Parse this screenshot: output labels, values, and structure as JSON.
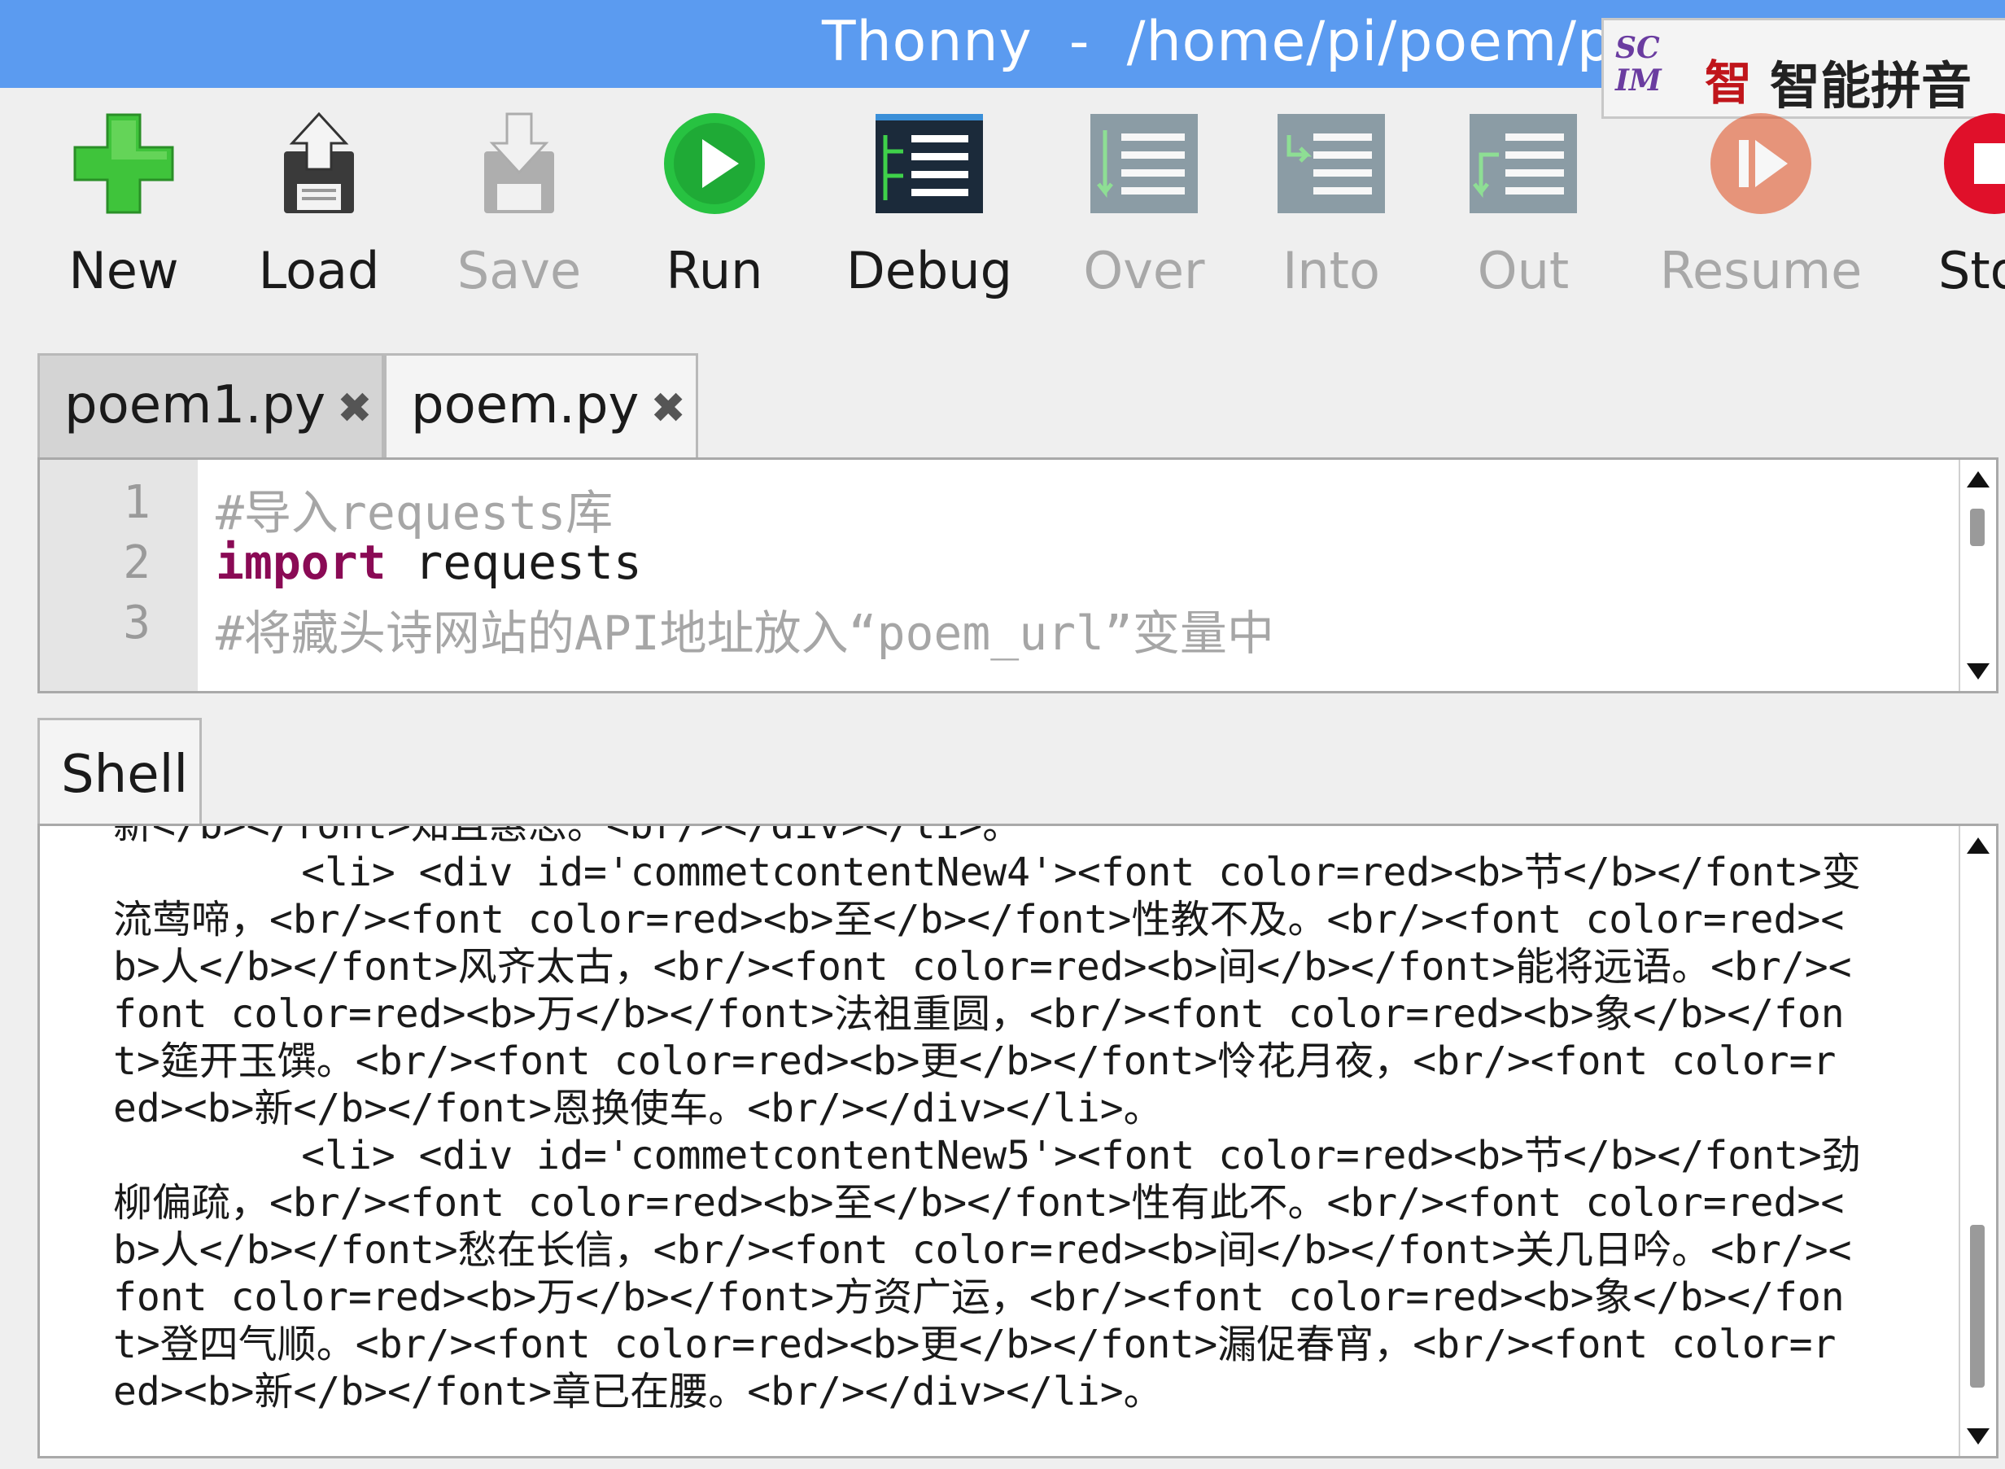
{
  "window": {
    "title": "Thonny  -  /home/pi/poem/poem"
  },
  "ime": {
    "logo_line1": "SC",
    "logo_line2": "IM",
    "mode": "智",
    "name": "智能拼音"
  },
  "toolbar": {
    "new": "New",
    "load": "Load",
    "save": "Save",
    "run": "Run",
    "debug": "Debug",
    "over": "Over",
    "into": "Into",
    "out": "Out",
    "resume": "Resume",
    "stop": "Sto"
  },
  "editor_tabs": [
    {
      "label": "poem1.py",
      "close": "✖"
    },
    {
      "label": "poem.py",
      "close": "✖"
    }
  ],
  "editor": {
    "line_numbers": [
      "1",
      "2",
      "3"
    ],
    "lines": [
      {
        "text": "#导入requests库"
      },
      {
        "keyword": "import",
        "text": " requests"
      },
      {
        "text": "#将藏头诗网站的API地址放入“poem_url”变量中"
      }
    ]
  },
  "shell": {
    "tab": "Shell",
    "lines": [
      "新</b></font>知且惠思。<br/></div></li>。",
      "        <li> <div id='commetcontentNew4'><font color=red><b>节</b></font>变",
      "流莺啼，<br/><font color=red><b>至</b></font>性教不及。<br/><font color=red><",
      "b>人</b></font>风齐太古，<br/><font color=red><b>间</b></font>能将远语。<br/><",
      "font color=red><b>万</b></font>法祖重圆，<br/><font color=red><b>象</b></fon",
      "t>筵开玉馔。<br/><font color=red><b>更</b></font>怜花月夜，<br/><font color=r",
      "ed><b>新</b></font>恩换使车。<br/></div></li>。",
      "        <li> <div id='commetcontentNew5'><font color=red><b>节</b></font>劲",
      "柳偏疏，<br/><font color=red><b>至</b></font>性有此不。<br/><font color=red><",
      "b>人</b></font>愁在长信，<br/><font color=red><b>间</b></font>关几日吟。<br/><",
      "font color=red><b>万</b></font>方资广运，<br/><font color=red><b>象</b></fon",
      "t>登四气顺。<br/><font color=red><b>更</b></font>漏促春宵，<br/><font color=r",
      "ed><b>新</b></font>章已在腰。<br/></div></li>。"
    ]
  }
}
